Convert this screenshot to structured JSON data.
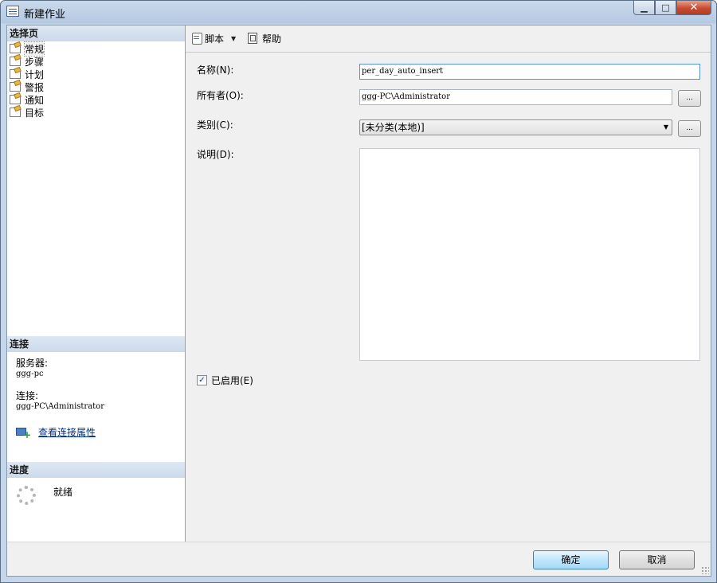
{
  "window": {
    "title": "新建作业",
    "controls": {
      "minimize": "▁",
      "maximize": "□",
      "close": "✕"
    }
  },
  "left_panel": {
    "pages_header": "选择页",
    "pages": [
      {
        "label": "常规",
        "icon": "page-icon",
        "selected": true
      },
      {
        "label": "步骤",
        "icon": "page-icon"
      },
      {
        "label": "计划",
        "icon": "page-icon"
      },
      {
        "label": "警报",
        "icon": "page-icon"
      },
      {
        "label": "通知",
        "icon": "page-icon"
      },
      {
        "label": "目标",
        "icon": "page-icon"
      }
    ],
    "connection_header": "连接",
    "server_label": "服务器:",
    "server_value": "ggg-pc",
    "connection_label": "连接:",
    "connection_value": "ggg-PC\\Administrator",
    "view_props_link": "查看连接属性",
    "progress_header": "进度",
    "progress_status": "就绪"
  },
  "toolbar": {
    "script_label": "脚本",
    "help_label": "帮助"
  },
  "form": {
    "name_label": "名称(N):",
    "name_value": "per_day_auto_insert",
    "owner_label": "所有者(O):",
    "owner_value": "ggg-PC\\Administrator",
    "category_label": "类别(C):",
    "category_value": "[未分类(本地)]",
    "description_label": "说明(D):",
    "description_value": "",
    "browse_label": "...",
    "enabled_label": "已启用(E)",
    "enabled": true
  },
  "footer": {
    "ok_label": "确定",
    "cancel_label": "取消"
  },
  "colors": {
    "title_bg": "#b5c9e2",
    "section_header_bg": "#cbd9ea",
    "link": "#00308f",
    "close_button": "#c74b33"
  }
}
